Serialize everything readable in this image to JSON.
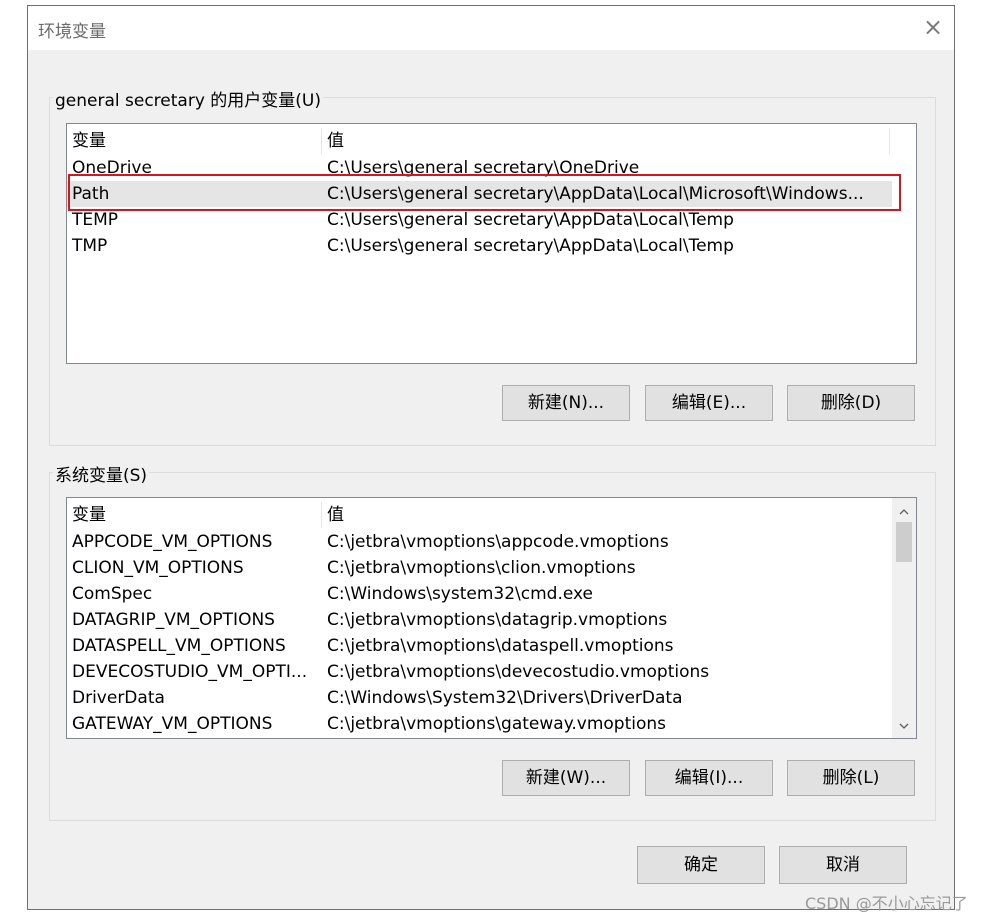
{
  "window": {
    "title": "环境变量",
    "close_icon": "×"
  },
  "user_vars": {
    "group_label": "general secretary 的用户变量(U)",
    "col_name": "变量",
    "col_value": "值",
    "rows": [
      {
        "name": "OneDrive",
        "value": "C:\\Users\\general secretary\\OneDrive"
      },
      {
        "name": "Path",
        "value": "C:\\Users\\general secretary\\AppData\\Local\\Microsoft\\Windows..."
      },
      {
        "name": "TEMP",
        "value": "C:\\Users\\general secretary\\AppData\\Local\\Temp"
      },
      {
        "name": "TMP",
        "value": "C:\\Users\\general secretary\\AppData\\Local\\Temp"
      }
    ],
    "new_button": "新建(N)...",
    "edit_button": "编辑(E)...",
    "delete_button": "删除(D)"
  },
  "system_vars": {
    "group_label": "系统变量(S)",
    "col_name": "变量",
    "col_value": "值",
    "rows": [
      {
        "name": "APPCODE_VM_OPTIONS",
        "value": "C:\\jetbra\\vmoptions\\appcode.vmoptions"
      },
      {
        "name": "CLION_VM_OPTIONS",
        "value": "C:\\jetbra\\vmoptions\\clion.vmoptions"
      },
      {
        "name": "ComSpec",
        "value": "C:\\Windows\\system32\\cmd.exe"
      },
      {
        "name": "DATAGRIP_VM_OPTIONS",
        "value": "C:\\jetbra\\vmoptions\\datagrip.vmoptions"
      },
      {
        "name": "DATASPELL_VM_OPTIONS",
        "value": "C:\\jetbra\\vmoptions\\dataspell.vmoptions"
      },
      {
        "name": "DEVECOSTUDIO_VM_OPTI...",
        "value": "C:\\jetbra\\vmoptions\\devecostudio.vmoptions"
      },
      {
        "name": "DriverData",
        "value": "C:\\Windows\\System32\\Drivers\\DriverData"
      },
      {
        "name": "GATEWAY_VM_OPTIONS",
        "value": "C:\\jetbra\\vmoptions\\gateway.vmoptions"
      }
    ],
    "new_button": "新建(W)...",
    "edit_button": "编辑(I)...",
    "delete_button": "删除(L)"
  },
  "footer": {
    "ok_button": "确定",
    "cancel_button": "取消"
  },
  "watermark": "CSDN @不小心忘记了"
}
